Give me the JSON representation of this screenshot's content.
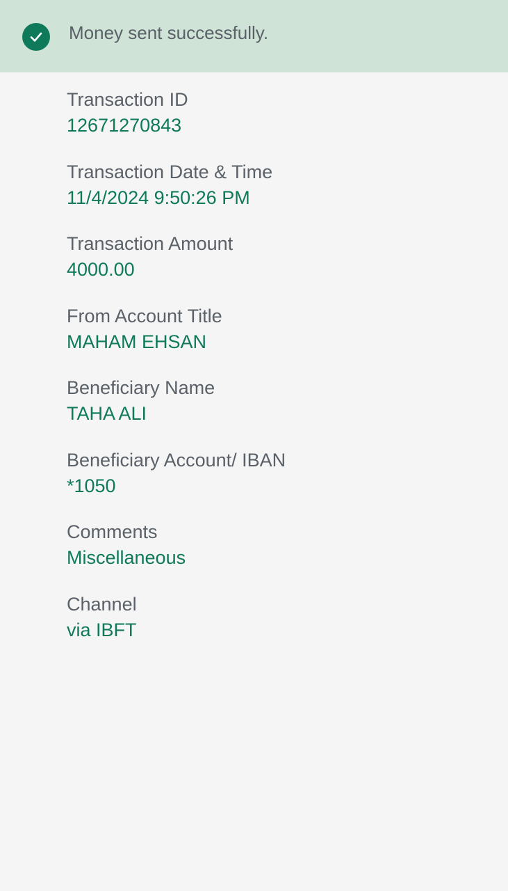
{
  "banner": {
    "message": "Money sent successfully.",
    "icon": "check-circle-icon",
    "icon_color": "#0f7a5a",
    "background": "#cfe3d6"
  },
  "fields": [
    {
      "label": "Transaction ID",
      "value": "12671270843"
    },
    {
      "label": "Transaction Date & Time",
      "value": "11/4/2024 9:50:26 PM"
    },
    {
      "label": "Transaction Amount",
      "value": "4000.00"
    },
    {
      "label": "From Account Title",
      "value": "MAHAM EHSAN"
    },
    {
      "label": "Beneficiary Name",
      "value": "TAHA ALI"
    },
    {
      "label": "Beneficiary Account/ IBAN",
      "value": "*1050"
    },
    {
      "label": "Comments",
      "value": "Miscellaneous"
    },
    {
      "label": "Channel",
      "value": "via IBFT"
    }
  ],
  "colors": {
    "label": "#5b6168",
    "value": "#0f7a5a",
    "page_background": "#f5f5f5"
  }
}
